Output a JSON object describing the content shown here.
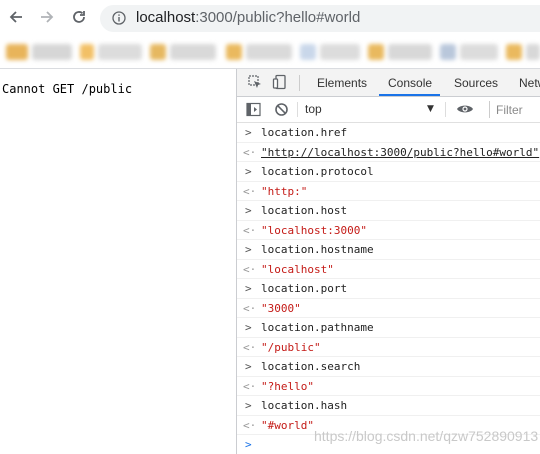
{
  "browser": {
    "url_host": "localhost",
    "url_rest": ":3000/public?hello#world"
  },
  "page": {
    "body_text": "Cannot GET /public"
  },
  "devtools": {
    "tabs": [
      "Elements",
      "Console",
      "Sources",
      "Netw"
    ],
    "active_tab": "Console",
    "context": "top",
    "filter_placeholder": "Filter"
  },
  "console": {
    "entries": [
      {
        "input": "location.href",
        "output": "\"http://localhost:3000/public?hello#world\"",
        "output_is_link": true
      },
      {
        "input": "location.protocol",
        "output": "\"http:\""
      },
      {
        "input": "location.host",
        "output": "\"localhost:3000\""
      },
      {
        "input": "location.hostname",
        "output": "\"localhost\""
      },
      {
        "input": "location.port",
        "output": "\"3000\""
      },
      {
        "input": "location.pathname",
        "output": "\"/public\""
      },
      {
        "input": "location.search",
        "output": "\"?hello\""
      },
      {
        "input": "location.hash",
        "output": "\"#world\""
      }
    ]
  },
  "watermark": "https://blog.csdn.net/qzw752890913",
  "colors": {
    "accent": "#1a73e8",
    "string": "#c41a16"
  }
}
